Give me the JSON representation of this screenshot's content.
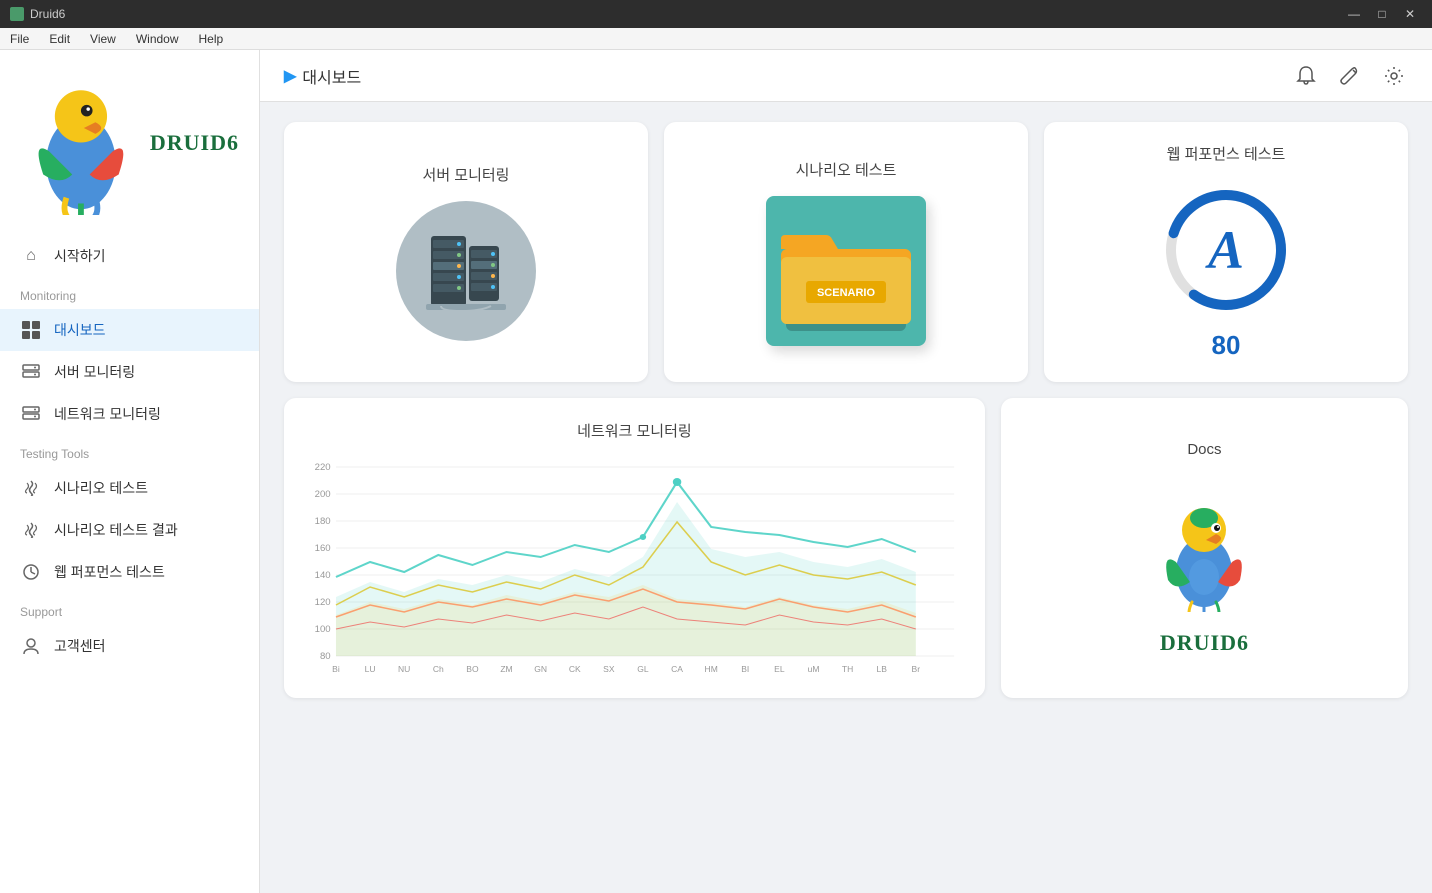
{
  "app": {
    "title": "Druid6",
    "logo_text": "DRUID6"
  },
  "titlebar": {
    "title": "Druid6",
    "minimize": "—",
    "maximize": "□",
    "close": "✕"
  },
  "menubar": {
    "items": [
      "File",
      "Edit",
      "View",
      "Window",
      "Help"
    ]
  },
  "sidebar": {
    "logo": "DRUID6",
    "sections": [
      {
        "label": "",
        "items": [
          {
            "id": "home",
            "label": "시작하기",
            "icon": "home"
          }
        ]
      },
      {
        "label": "Monitoring",
        "items": [
          {
            "id": "dashboard",
            "label": "대시보드",
            "icon": "grid",
            "active": true
          },
          {
            "id": "server-monitoring",
            "label": "서버 모니터링",
            "icon": "server"
          },
          {
            "id": "network-monitoring",
            "label": "네트워크 모니터링",
            "icon": "network"
          }
        ]
      },
      {
        "label": "Testing Tools",
        "items": [
          {
            "id": "scenario-test",
            "label": "시나리오 테스트",
            "icon": "wifi"
          },
          {
            "id": "scenario-result",
            "label": "시나리오 테스트 결과",
            "icon": "wifi"
          },
          {
            "id": "web-perf",
            "label": "웹 퍼포먼스 테스트",
            "icon": "gauge"
          }
        ]
      },
      {
        "label": "Support",
        "items": [
          {
            "id": "customer",
            "label": "고객센터",
            "icon": "headset"
          }
        ]
      }
    ]
  },
  "header": {
    "breadcrumb_arrow": "▶",
    "breadcrumb_text": "대시보드"
  },
  "cards": {
    "server": {
      "title": "서버 모니터링"
    },
    "scenario": {
      "title": "시나리오 테스트",
      "folder_label": "SCENARIO"
    },
    "webperf": {
      "title": "웹 퍼포먼스 테스트",
      "grade": "A",
      "score": "80"
    },
    "network": {
      "title": "네트워크 모니터링",
      "x_labels": [
        "Bi",
        "LU",
        "NU",
        "Ch",
        "BO",
        "ZM",
        "GN",
        "CK",
        "SX",
        "GL",
        "CA",
        "HM",
        "BI",
        "EL",
        "uM",
        "TH",
        "LB",
        "Br"
      ]
    },
    "docs": {
      "title": "Docs",
      "brand": "DRUID6"
    }
  }
}
